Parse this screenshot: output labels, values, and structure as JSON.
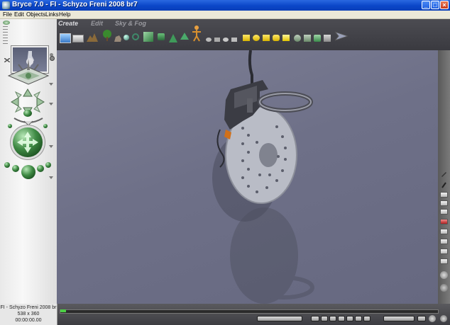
{
  "window": {
    "title": "Bryce 7.0 - FI - Schyzo Freni 2008 br7",
    "minimize": "_",
    "maximize": "□",
    "close": "×"
  },
  "menu": [
    "File",
    "Edit",
    "Objects",
    "Links",
    "Help"
  ],
  "toolbar": {
    "tabs": [
      "Create",
      "Edit",
      "Sky & Fog"
    ]
  },
  "status": {
    "document": "FI - Schyzo Freni 2008 br",
    "size": "538 x 360",
    "time": "00:00:00.00"
  },
  "colors": {
    "accent": "#0a46c8",
    "timeline_marker": "#4ccf46",
    "sphere_green": "#3f8a44"
  }
}
